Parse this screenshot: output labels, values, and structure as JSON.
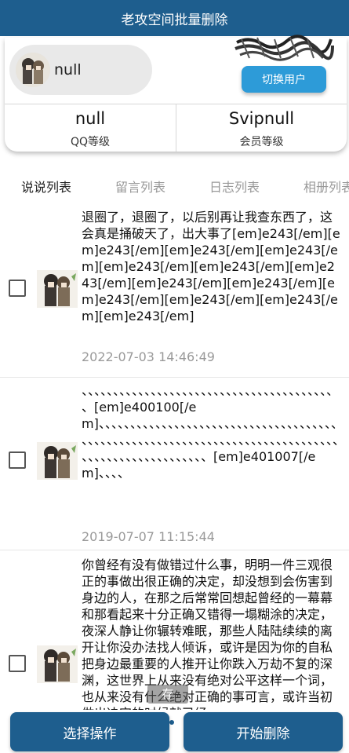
{
  "title": "老攻空间批量删除",
  "user": {
    "name": "null",
    "switch_label": "切换用户",
    "qq_level_value": "null",
    "qq_level_label": "QQ等级",
    "member_value": "Svipnull",
    "member_label": "会员等级"
  },
  "tabs": [
    "说说列表",
    "留言列表",
    "日志列表",
    "相册列表"
  ],
  "posts": [
    {
      "text": "退圈了，退圈了，以后别再让我查东西了，这会真是捅破天了，出大事了[em]e243[/em][em]e243[/em][em]e243[/em][em]e243[/em][em]e243[/em][em]e243[/em][em]e243[/em][em]e243[/em][em]e243[/em][em]e243[/em][em]e243[/em][em]e243[/em][em]e243[/em]",
      "time": "2022-07-03 14:46:49"
    },
    {
      "text": "、、、、、、、、、、、、、、、、、、、、、、、、、、、、、、、、、、、、、、、、、[em]e400100[/em]、、、、、、、、、、、、、、、、、、、、、、、、、、、、、、、、、、、、、、、、、、、、、、、、、、、、、、、、、、、、、、、、、、、、、、、、、、、、、、、、、、、、、、、、、、、、、、、、、、、[em]e401007[/em]、、、、",
      "time": "2019-07-07 11:15:44"
    },
    {
      "text": "你曾经有没有做错过什么事，明明一件三观很正的事做出很正确的决定，却没想到会伤害到身边的人，在那之后常常回想起曾经的一幕幕和那看起来十分正确又错得一塌糊涂的决定，夜深人静让你辗转难眠，那些人陆陆续续的离开让你没办法找人倾诉，或许是因为你的自私把身边最重要的人推开让你跌入万劫不复的深渊，这世界上从来没有绝对公平这样一个词，也从来没有什么绝对正确的事可言，或许当初做出决定的时候就已经"
    }
  ],
  "overlay_text": "存",
  "bottom": {
    "select_label": "选择操作",
    "delete_label": "开始删除"
  },
  "colors": {
    "primary": "#1e5e8e",
    "switch_button": "#2d9bd8"
  }
}
